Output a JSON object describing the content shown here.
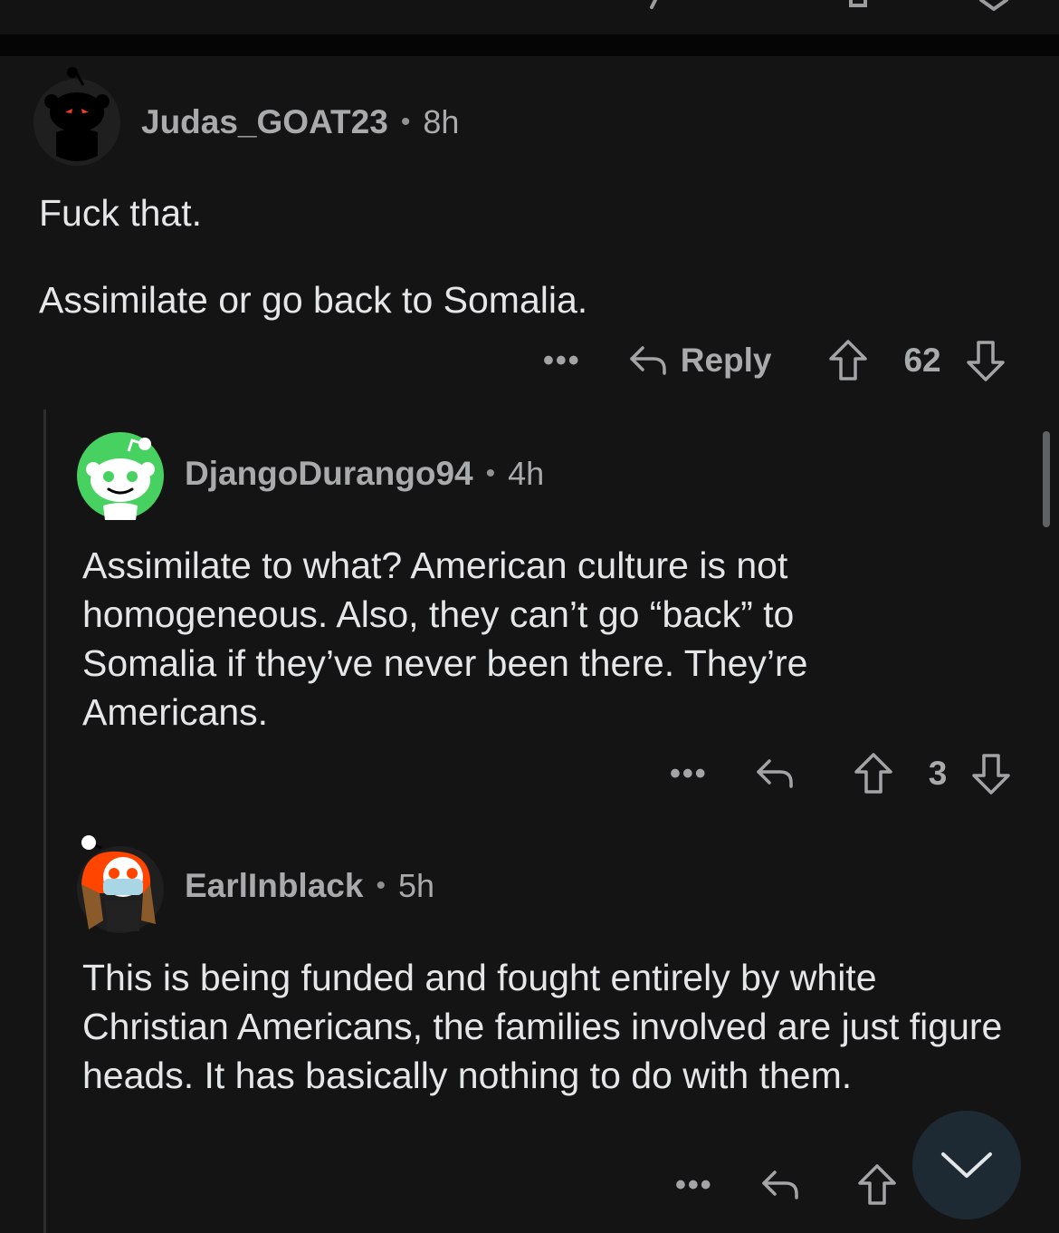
{
  "comments": [
    {
      "username": "Judas_GOAT23",
      "time": "8h",
      "paragraphs": [
        "Fuck that.",
        "Assimilate or go back to Somalia."
      ],
      "reply_label": "Reply",
      "score": "62"
    },
    {
      "username": "DjangoDurango94",
      "time": "4h",
      "paragraphs": [
        "Assimilate to what? American culture is not homogeneous. Also, they can’t go “back” to Somalia if they’ve never been there. They’re Americans."
      ],
      "score": "3"
    },
    {
      "username": "EarlInblack",
      "time": "5h",
      "paragraphs": [
        "This is being funded and fought entirely by white Christian Americans, the families involved are just figure heads. It has basically nothing to do with them."
      ]
    }
  ],
  "separator_dot": "•",
  "more_glyph": "•••",
  "icons": {
    "more": "more-options-icon",
    "reply": "reply-arrow-icon",
    "upvote": "upvote-arrow-icon",
    "downvote": "downvote-arrow-icon",
    "scroll_down": "chevron-down-icon"
  },
  "colors": {
    "background": "#141414",
    "text": "#e4e6e8",
    "meta": "#a8aaab",
    "avatar_green": "#46d160",
    "avatar_orange": "#ff4500",
    "fab": "#1d2a33"
  }
}
